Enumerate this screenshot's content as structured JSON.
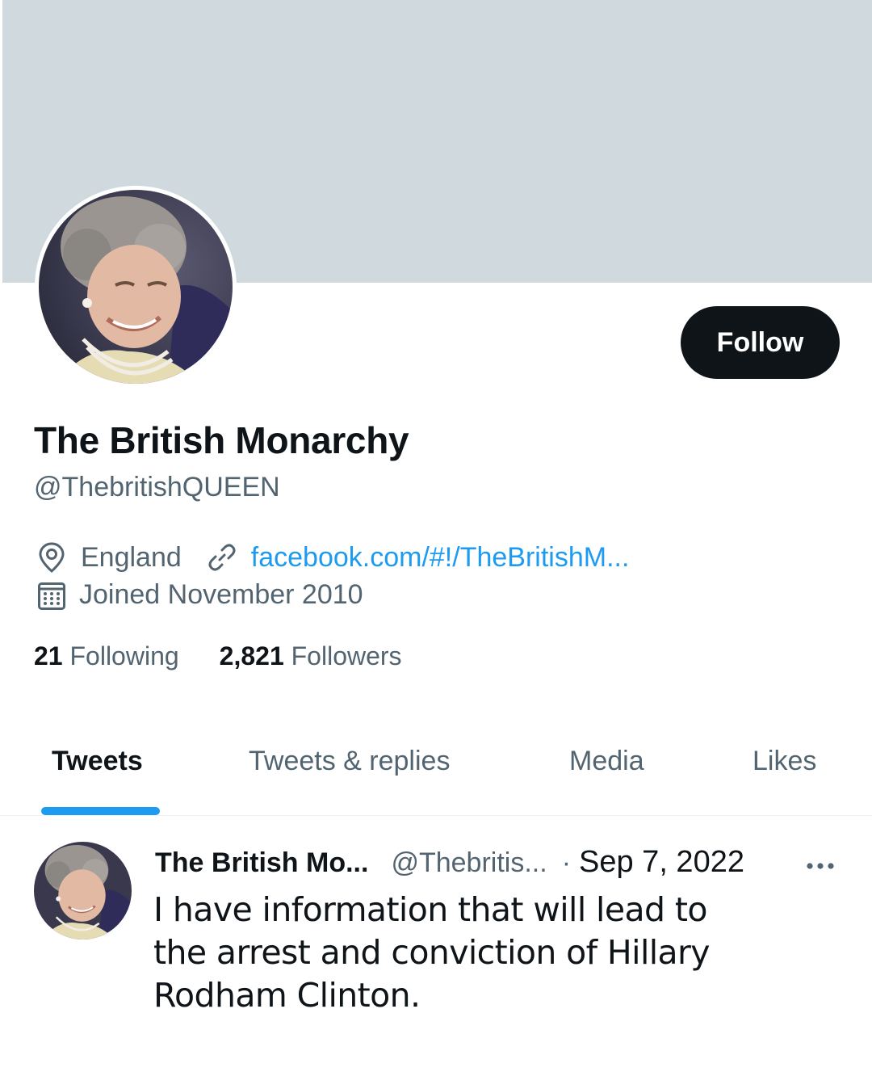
{
  "profile": {
    "display_name": "The British Monarchy",
    "handle": "@ThebritishQUEEN",
    "location": "England",
    "website": "facebook.com/#!/TheBritishM...",
    "joined": "Joined November 2010",
    "following_count": "21",
    "following_label": "Following",
    "followers_count": "2,821",
    "followers_label": "Followers",
    "follow_button": "Follow"
  },
  "icons": {
    "location": "location-pin-icon",
    "link": "link-icon",
    "calendar": "calendar-icon",
    "more": "more-dots-icon"
  },
  "tabs": [
    {
      "label": "Tweets",
      "active": true
    },
    {
      "label": "Tweets & replies",
      "active": false
    },
    {
      "label": "Media",
      "active": false
    },
    {
      "label": "Likes",
      "active": false
    }
  ],
  "tweet": {
    "author_name": "The British Mo...",
    "author_handle": "@Thebritis...",
    "separator": "·",
    "date": "Sep 7, 2022",
    "text": "I have information that will lead to the arrest and conviction of Hillary Rodham Clinton."
  },
  "colors": {
    "banner": "#cfd9de",
    "accent": "#1d9bf0",
    "text_primary": "#0f1419",
    "text_secondary": "#536471"
  }
}
